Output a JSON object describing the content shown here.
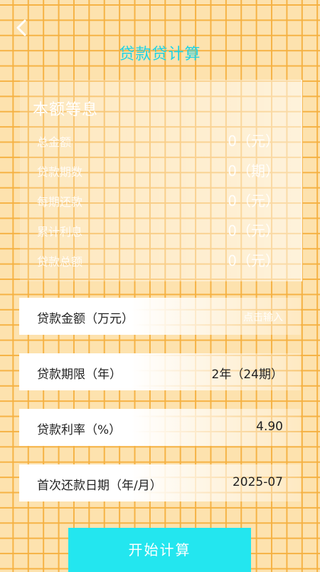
{
  "header": {
    "title": "贷款贷计算",
    "back_icon": "chevron-left-icon"
  },
  "summary": {
    "title": "本额等息",
    "rows": [
      {
        "label": "总金额",
        "value": "0（元）"
      },
      {
        "label": "贷款期数",
        "value": "0（期）"
      },
      {
        "label": "每期还款",
        "value": "0（元）"
      },
      {
        "label": "累计利息",
        "value": "0（元）"
      },
      {
        "label": "贷款总额",
        "value": "0（元）"
      }
    ]
  },
  "form": {
    "amount": {
      "label": "贷款金额（万元）",
      "placeholder": "点击输入"
    },
    "term": {
      "label": "贷款期限（年）",
      "value": "2年（24期）"
    },
    "rate": {
      "label": "贷款利率（%）",
      "value": "4.90"
    },
    "first_date": {
      "label": "首次还款日期（年/月）",
      "value": "2025-07"
    }
  },
  "actions": {
    "start_label": "开始计算"
  },
  "colors": {
    "accent": "#1fd3e4",
    "button": "#23e6ef",
    "grid": "#f5b040",
    "background": "#fde2ae"
  }
}
